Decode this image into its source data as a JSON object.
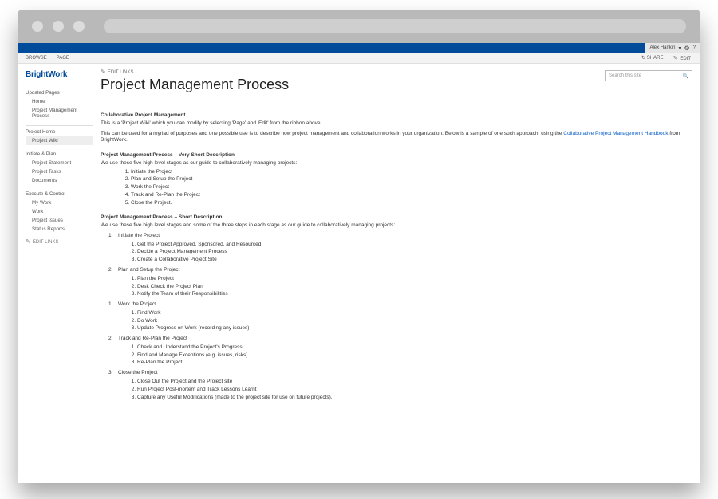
{
  "user": {
    "name": "Alex Hankin"
  },
  "ribbon": {
    "tabs": {
      "browse": "BROWSE",
      "page": "PAGE"
    },
    "actions": {
      "share": "SHARE",
      "edit": "EDIT"
    }
  },
  "logo": "BrightWork",
  "sidebar": {
    "updated_pages": {
      "head": "Updated Pages",
      "home": "Home",
      "pmp": "Project Management Process"
    },
    "project_home": {
      "head": "Project Home",
      "wiki": "Project Wiki"
    },
    "initiate": {
      "head": "Initiate & Plan",
      "stmt": "Project Statement",
      "tasks": "Project Tasks",
      "docs": "Documents"
    },
    "execute": {
      "head": "Execute & Control",
      "mywork": "My Work",
      "work": "Work",
      "issues": "Project Issues",
      "status": "Status Reports"
    },
    "edit_links": "EDIT LINKS"
  },
  "main": {
    "edit_links": "EDIT LINKS",
    "title": "Project Management Process",
    "search_placeholder": "Search this site",
    "h1": "Collaborative Project Management",
    "p1": "This is a 'Project Wiki' which you can modify by selecting 'Page' and 'Edit' from the ribbon above.",
    "p2a": "This can be used for a myriad of purposes and one possible use is to describe how project management and collaboration works in your organization. Below is a sample of one such approach, using the ",
    "p2link": "Collaborative Project Management Handbook",
    "p2b": " from BrightWork.",
    "h2": "Project Management Process – Very Short Description",
    "h2sub": "We use these five high level stages as our guide to collaboratively managing projects:",
    "short_list": [
      "Initiate the Project",
      "Plan and Setup the Project",
      "Work the Project",
      "Track and Re-Plan the Project",
      "Close the Project."
    ],
    "h3": "Project Management Process – Short Description",
    "h3sub": "We use these five high level stages and some of the three steps in each stage as our guide to collaboratively managing projects:",
    "stages": [
      {
        "num": "1.",
        "label": "Initiate the Project",
        "items": [
          "Get the Project Approved, Sponsored, and Resourced",
          "Decide a Project Management Process",
          "Create a Collaborative Project Site"
        ]
      },
      {
        "num": "2.",
        "label": "Plan and Setup the Project",
        "items": [
          "Plan the Project",
          "Desk Check the Project Plan",
          "Notify the Team of their Responsibilities"
        ]
      },
      {
        "num": "1.",
        "label": "Work the Project",
        "items": [
          "Find Work",
          "Do Work",
          "Update Progress on Work (recording any issues)"
        ]
      },
      {
        "num": "2.",
        "label": "Track and Re-Plan the Project",
        "items": [
          "Check and Understand the Project's Progress",
          "Find and Manage Exceptions (e.g. issues, risks)",
          "Re-Plan the Project"
        ]
      },
      {
        "num": "3.",
        "label": "Close the Project",
        "items": [
          "Close Out the Project and the Project site",
          "Run Project Post-mortem and Track Lessons Learnt",
          "Capture any Useful Modifications (made to the project site for use on future projects)."
        ]
      }
    ]
  }
}
